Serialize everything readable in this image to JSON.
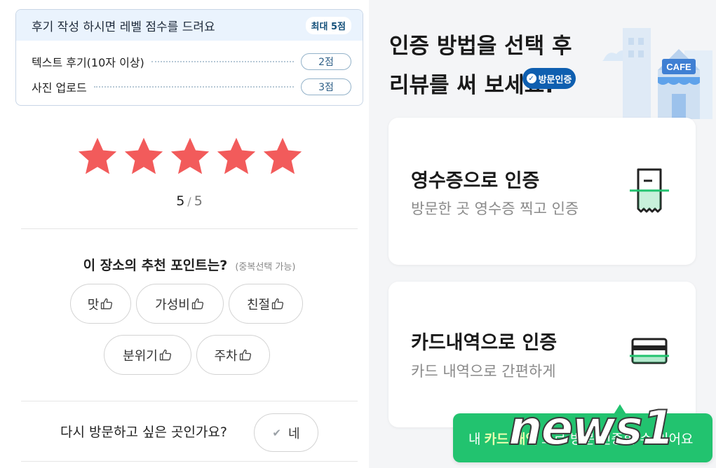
{
  "points_box": {
    "title": "후기 작성 하시면 레벨 점수를 드려요",
    "max_badge": "최대 5점",
    "rows": [
      {
        "label": "텍스트 후기(10자 이상)",
        "points": "2점"
      },
      {
        "label": "사진 업로드",
        "points": "3점"
      }
    ]
  },
  "rating": {
    "current": "5",
    "separator": "/",
    "max": "5",
    "stars_filled": 5,
    "star_color": "#f25b5b"
  },
  "recommend": {
    "title": "이 장소의 추천 포인트는?",
    "note": "(중복선택 가능)",
    "chips": [
      "맛",
      "가성비",
      "친절",
      "분위기",
      "주차"
    ]
  },
  "revisit": {
    "question": "다시 방문하고 싶은 곳인가요?",
    "yes_label": "네"
  },
  "verify": {
    "headline_line1": "인증 방법을 선택 후",
    "headline_line2": "리뷰를 써 보세요!",
    "badge": "방문인증",
    "cafe_sign": "CAFE",
    "options": [
      {
        "title": "영수증으로 인증",
        "subtitle": "방문한 곳 영수증 찍고 인증",
        "icon": "receipt-icon"
      },
      {
        "title": "카드내역으로 인증",
        "subtitle": "카드 내역으로 간편하게",
        "icon": "credit-card-icon"
      }
    ],
    "cta_prefix": "내",
    "cta_emphasis": "카드 내역",
    "cta_suffix": "으로 방문 인증할 수 있어요",
    "accent": "#22c36f",
    "badge_color": "#0f5fb0"
  },
  "watermark": {
    "text": "news1"
  }
}
